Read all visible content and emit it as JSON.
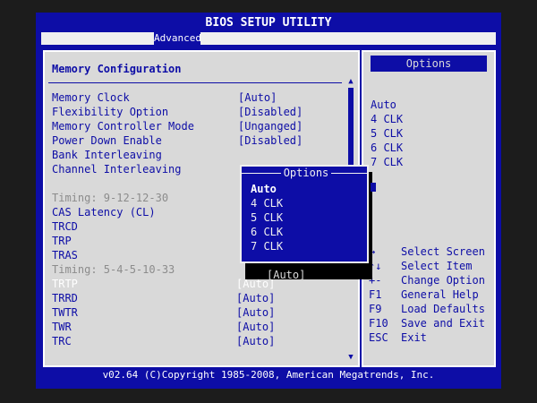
{
  "title": "BIOS SETUP UTILITY",
  "tabs": {
    "active": "Advanced"
  },
  "section": {
    "title": "Memory Configuration"
  },
  "settings": {
    "memory_clock": {
      "label": "Memory Clock",
      "value": "[Auto]"
    },
    "flexibility": {
      "label": "Flexibility Option",
      "value": "[Disabled]"
    },
    "controller_mode": {
      "label": "Memory Controller Mode",
      "value": "[Unganged]"
    },
    "power_down": {
      "label": "Power Down Enable",
      "value": "[Disabled]"
    },
    "bank_interleaving": {
      "label": "Bank Interleaving"
    },
    "channel_interleaving": {
      "label": "Channel Interleaving"
    },
    "timing_1": {
      "label": "Timing: 9-12-12-30"
    },
    "cas_latency": {
      "label": "CAS Latency (CL)"
    },
    "trcd": {
      "label": "TRCD"
    },
    "trp": {
      "label": "TRP"
    },
    "tras": {
      "label": "TRAS"
    },
    "timing_2": {
      "label": "Timing: 5-4-5-10-33"
    },
    "trtp": {
      "label": "TRTP",
      "value": "[Auto]"
    },
    "trrd": {
      "label": "TRRD",
      "value": "[Auto]"
    },
    "twtr": {
      "label": "TWTR",
      "value": "[Auto]"
    },
    "twr": {
      "label": "TWR",
      "value": "[Auto]"
    },
    "trc": {
      "label": "TRC",
      "value": "[Auto]"
    },
    "hidden_value": "[Auto]"
  },
  "right_panel": {
    "header": "Options",
    "options": [
      "Auto",
      "4 CLK",
      "5 CLK",
      "6 CLK",
      "7 CLK"
    ]
  },
  "help": {
    "select_screen": {
      "key": "↔",
      "desc": "Select Screen"
    },
    "select_item": {
      "key": "↑↓",
      "desc": "Select Item"
    },
    "change_option": {
      "key": "+-",
      "desc": "Change Option"
    },
    "general_help": {
      "key": "F1",
      "desc": "General Help"
    },
    "load_defaults": {
      "key": "F9",
      "desc": "Load Defaults"
    },
    "save_exit": {
      "key": "F10",
      "desc": "Save and Exit"
    },
    "exit": {
      "key": "ESC",
      "desc": "Exit"
    }
  },
  "popup": {
    "title": "Options",
    "options": [
      "Auto",
      "4 CLK",
      "5 CLK",
      "6 CLK",
      "7 CLK"
    ],
    "selected": "Auto"
  },
  "footer": "v02.64 (C)Copyright 1985-2008, American Megatrends, Inc.",
  "colors": {
    "bios_blue": "#0d0da6",
    "panel_gray": "#d9d9d9",
    "white": "#ffffff",
    "muted": "#8c8c8c"
  }
}
